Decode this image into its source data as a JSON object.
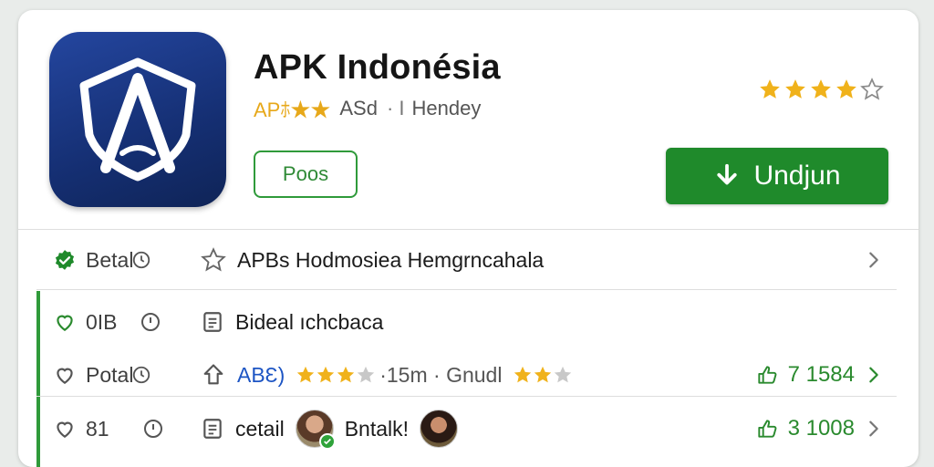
{
  "app": {
    "title": "APK Indonésia",
    "brand": "APﾎ★★",
    "meta_a": "ASd",
    "meta_sep": "· I",
    "meta_b": "Hendey",
    "rating_stars": 4,
    "rating_max": 5
  },
  "buttons": {
    "secondary_label": "Poos",
    "download_label": "Undjun"
  },
  "rows": [
    {
      "left_label": "Betal",
      "main_text": "APBs Hodmosiea  Hemgrncahala"
    },
    {
      "left_label": "0IB",
      "main_text": "Bideal ıchcbaca"
    },
    {
      "left_label": "Potal",
      "main_text_blue": "ABƐ)",
      "stars_a": 3,
      "mid_text": "·15m · Gnudl",
      "stars_b": 2,
      "count": "7 1584"
    },
    {
      "left_label": "81",
      "main_text": "cetail",
      "name_text": "Bntalk!",
      "count": "3 1008"
    }
  ],
  "colors": {
    "accent_green": "#1f8a2b",
    "star_gold": "#f0b21b",
    "icon_blue": "#1a3a8a"
  },
  "icons": [
    "shield-a-app-icon",
    "star-icon",
    "download-arrow-icon",
    "check-badge-icon",
    "heart-icon",
    "clock-icon",
    "document-icon",
    "chevron-right-icon",
    "thumbs-up-icon"
  ]
}
